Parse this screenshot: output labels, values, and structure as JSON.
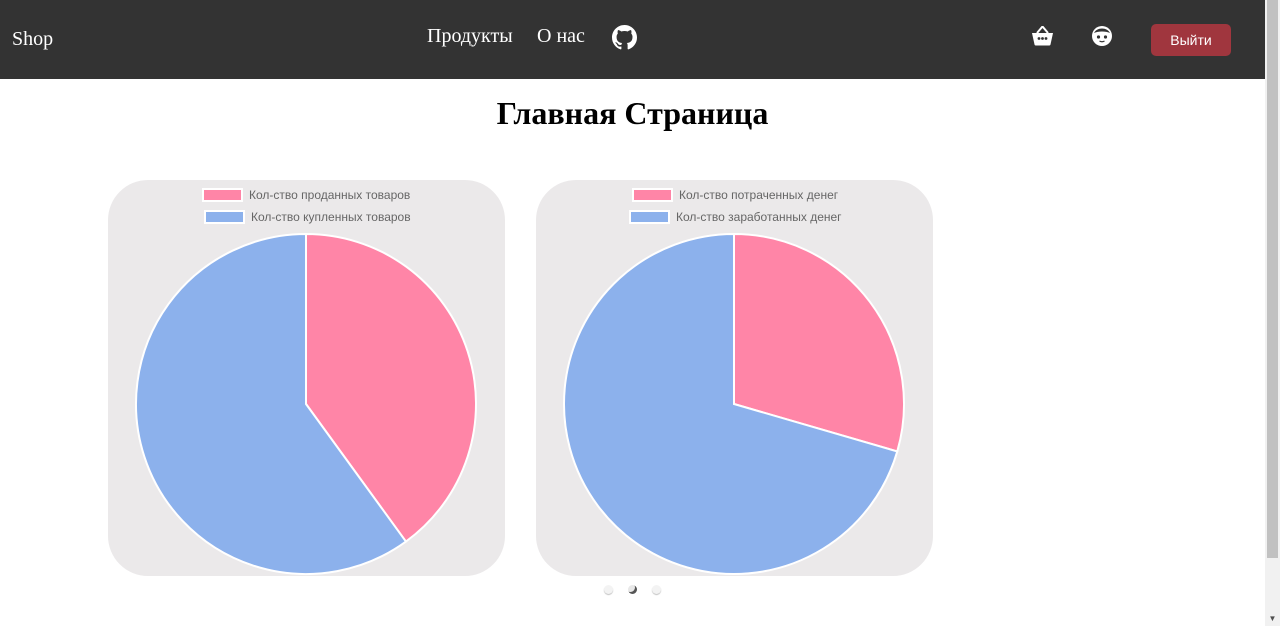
{
  "navbar": {
    "brand": "Shop",
    "links": [
      {
        "label": "Продукты"
      },
      {
        "label": "О нас"
      }
    ],
    "github_icon": "github-icon",
    "cart_icon": "basket-icon",
    "profile_icon": "face-icon",
    "logout_label": "Выйти"
  },
  "page": {
    "title": "Главная Страница"
  },
  "colors": {
    "navbar": "#333333",
    "logout": "#a0363e",
    "pink": "#ff85a7",
    "blue": "#8cb1ec",
    "card": "#ebe9ea"
  },
  "carousel": {
    "dots": 3,
    "active_index": 1
  },
  "chart_data": [
    {
      "type": "pie",
      "legend_position": "top",
      "series": [
        {
          "name": "Кол-ство проданных товаров",
          "value": 40,
          "color": "#ff85a7"
        },
        {
          "name": "Кол-ство купленных товаров",
          "value": 60,
          "color": "#8cb1ec"
        }
      ]
    },
    {
      "type": "pie",
      "legend_position": "top",
      "series": [
        {
          "name": "Кол-ство потраченных денег",
          "value": 29.5,
          "color": "#ff85a7"
        },
        {
          "name": "Кол-ство заработанных денег",
          "value": 70.5,
          "color": "#8cb1ec"
        }
      ]
    }
  ]
}
